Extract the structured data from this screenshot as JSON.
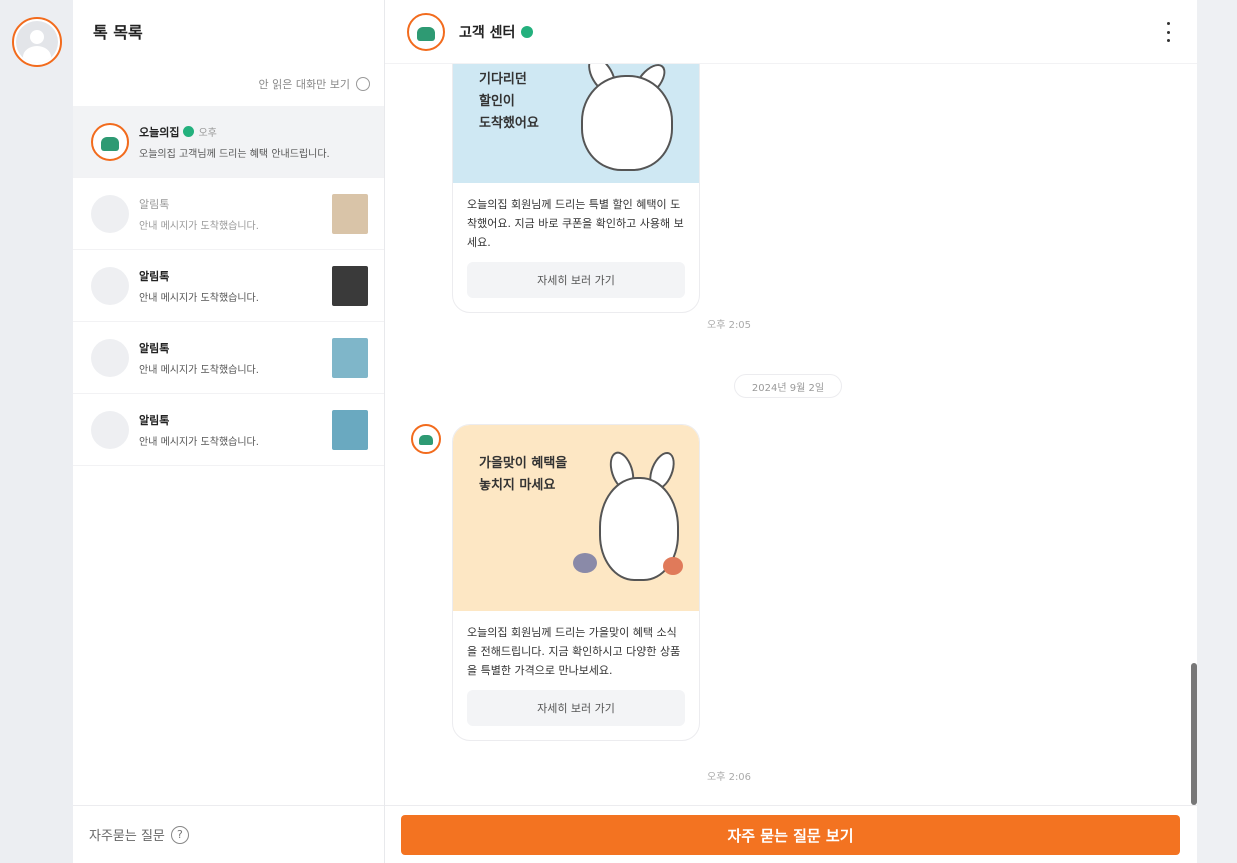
{
  "sidebar": {
    "title": "톡 목록",
    "toolbar_text": "안 읽은 대화만 보기",
    "faq_link": "자주묻는 질문",
    "help_glyph": "?",
    "chats": [
      {
        "name": "오늘의집",
        "time": "오후",
        "preview": "오늘의집 고객님께 드리는 혜택 안내드립니다.",
        "active": true
      },
      {
        "name": "알림톡",
        "time": "",
        "preview": "안내 메시지가 도착했습니다.",
        "thumb_color": "#d9c4a8"
      },
      {
        "name": "알림톡",
        "time": "",
        "preview": "안내 메시지가 도착했습니다.",
        "thumb_color": "#3a3a3a"
      },
      {
        "name": "알림톡",
        "time": "",
        "preview": "안내 메시지가 도착했습니다.",
        "thumb_color": "#7fb6c9"
      },
      {
        "name": "알림톡",
        "time": "",
        "preview": "안내 메시지가 도착했습니다.",
        "thumb_color": "#6aa9c0"
      }
    ]
  },
  "conversation": {
    "title": "고객 센터",
    "messages": [
      {
        "image_caption": [
          "기다리던",
          "할인이",
          "도착했어요"
        ],
        "image_bg": "#cfe8f3",
        "text": "오늘의집 회원님께 드리는 특별 할인 혜택이 도착했어요. 지금 바로 쿠폰을 확인하고 사용해 보세요.",
        "button": "자세히 보러 가기",
        "time": "오후 2:05"
      },
      {
        "image_caption": [
          "가을맞이 혜택을",
          "놓치지 마세요"
        ],
        "image_bg": "#fde7c4",
        "text": "오늘의집 회원님께 드리는 가을맞이 혜택 소식을 전해드립니다. 지금 확인하시고 다양한 상품을 특별한 가격으로 만나보세요.",
        "button": "자세히 보러 가기",
        "time": "오후 2:06"
      }
    ],
    "date_divider": "2024년 9월 2일",
    "faq_button": "자주 묻는 질문 보기"
  },
  "colors": {
    "accent": "#f37321",
    "verified": "#23b07d"
  }
}
